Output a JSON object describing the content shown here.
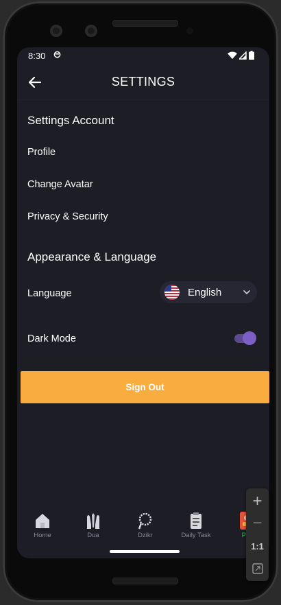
{
  "status_bar": {
    "time": "8:30"
  },
  "app_bar": {
    "title": "SETTINGS"
  },
  "account_section": {
    "title": "Settings Account",
    "items": [
      "Profile",
      "Change Avatar",
      "Privacy & Security"
    ]
  },
  "appearance_section": {
    "title": "Appearance & Language",
    "language_label": "Language",
    "language_value": "English",
    "dark_mode_label": "Dark Mode",
    "dark_mode_on": true
  },
  "sign_out_label": "Sign Out",
  "bottom_nav": [
    {
      "label": "Home",
      "icon": "home-icon"
    },
    {
      "label": "Dua",
      "icon": "praying-hands-icon"
    },
    {
      "label": "Dzikr",
      "icon": "prayer-beads-icon"
    },
    {
      "label": "Daily Task",
      "icon": "clipboard-icon"
    },
    {
      "label": "Pro",
      "icon": "profile-icon"
    }
  ],
  "zoom_controls": {
    "reset_label": "1:1"
  },
  "colors": {
    "background": "#1d1d26",
    "accent_button": "#f9ad3f",
    "toggle": "#7b5fc4",
    "active_nav": "#1ec94b"
  }
}
